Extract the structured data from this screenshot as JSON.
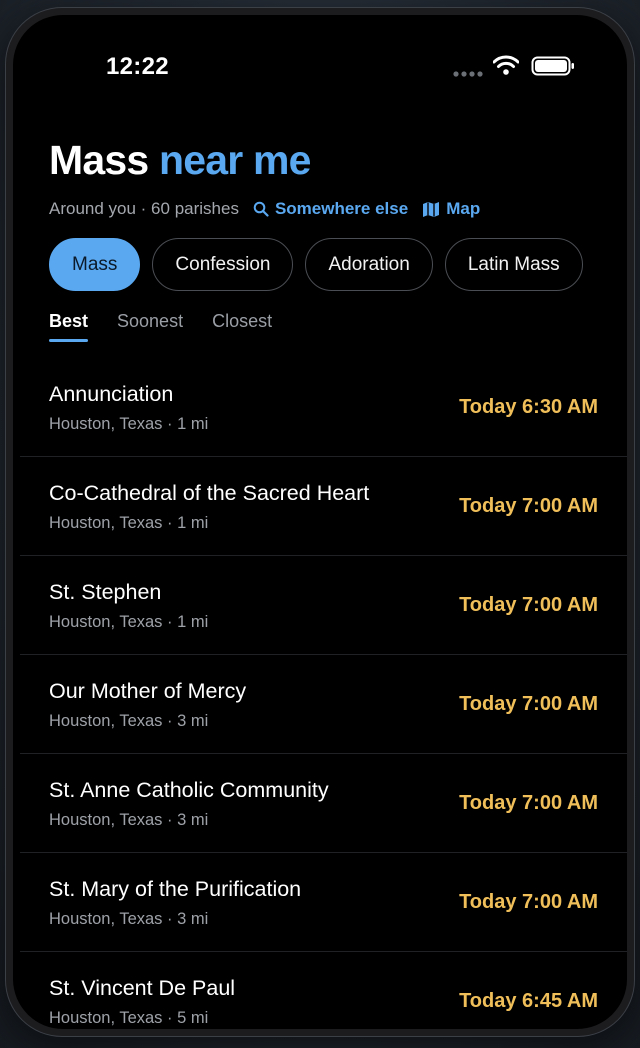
{
  "status_bar": {
    "time": "12:22"
  },
  "header": {
    "title_main": "Mass",
    "title_accent": "near me",
    "subtitle": "Around you · 60 parishes",
    "link_somewhere": "Somewhere else",
    "link_map": "Map"
  },
  "chips": [
    {
      "label": "Mass",
      "active": true
    },
    {
      "label": "Confession",
      "active": false
    },
    {
      "label": "Adoration",
      "active": false
    },
    {
      "label": "Latin Mass",
      "active": false
    }
  ],
  "sort_tabs": [
    {
      "label": "Best",
      "active": true
    },
    {
      "label": "Soonest",
      "active": false
    },
    {
      "label": "Closest",
      "active": false
    }
  ],
  "parishes": [
    {
      "name": "Annunciation",
      "location": "Houston, Texas · 1 mi",
      "time": "Today 6:30 AM"
    },
    {
      "name": "Co-Cathedral of the Sacred Heart",
      "location": "Houston, Texas · 1 mi",
      "time": "Today 7:00 AM"
    },
    {
      "name": "St. Stephen",
      "location": "Houston, Texas · 1 mi",
      "time": "Today 7:00 AM"
    },
    {
      "name": "Our Mother of Mercy",
      "location": "Houston, Texas · 3 mi",
      "time": "Today 7:00 AM"
    },
    {
      "name": "St. Anne Catholic Community",
      "location": "Houston, Texas · 3 mi",
      "time": "Today 7:00 AM"
    },
    {
      "name": "St. Mary of the Purification",
      "location": "Houston, Texas · 3 mi",
      "time": "Today 7:00 AM"
    },
    {
      "name": "St. Vincent De Paul",
      "location": "Houston, Texas · 5 mi",
      "time": "Today 6:45 AM"
    }
  ],
  "colors": {
    "accent": "#5aa8f0",
    "time": "#f0bf5a",
    "background": "#000000"
  },
  "icons": {
    "signal": "signal-dots-icon",
    "wifi": "wifi-icon",
    "battery": "battery-icon",
    "search": "search-icon",
    "map": "map-icon"
  }
}
